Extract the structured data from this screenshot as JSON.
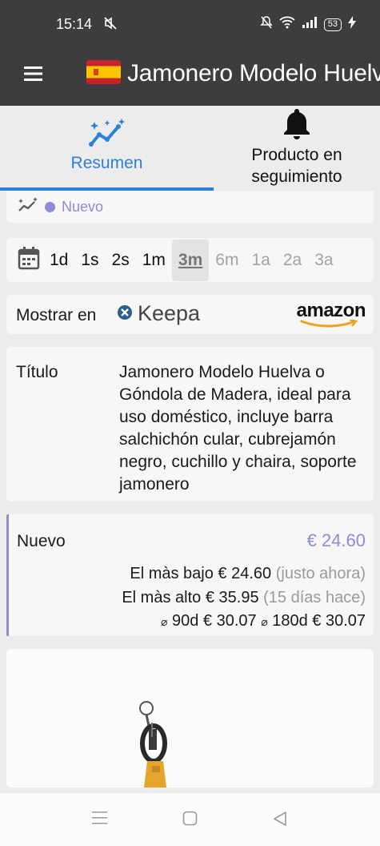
{
  "status_bar": {
    "time": "15:14",
    "battery": "53"
  },
  "app_bar": {
    "title": "Jamonero Modelo Huelva o Góndola de Madera"
  },
  "tabs": [
    {
      "label": "Resumen"
    },
    {
      "label": "Producto en seguimiento"
    }
  ],
  "condition_chip": {
    "label": "Nuevo"
  },
  "range": {
    "options": [
      "1d",
      "1s",
      "2s",
      "1m",
      "3m",
      "6m",
      "1a",
      "2a",
      "3a"
    ],
    "selected": "3m"
  },
  "show_in": {
    "label": "Mostrar en",
    "keepa": "Keepa",
    "amazon": "amazon"
  },
  "product": {
    "title_label": "Título",
    "title": "Jamonero Modelo Huelva o Góndola de Madera, ideal para uso doméstico, incluye barra salchichón cular, cubrejamón negro, cuchillo y chaira, soporte jamonero"
  },
  "price": {
    "condition": "Nuevo",
    "current": "€ 24.60",
    "lowest_label": "El màs bajo",
    "lowest_value": "€ 24.60",
    "lowest_note": "(justo ahora)",
    "highest_label": "El màs alto",
    "highest_value": "€ 35.95",
    "highest_note": "(15 días hace)",
    "avg_symbol": "⌀",
    "avg90_label": "90d",
    "avg90_value": "€ 30.07",
    "avg180_label": "180d",
    "avg180_value": "€ 30.07"
  },
  "colors": {
    "accent": "#2f80d8",
    "condition": "#8c8cd8",
    "bar": "#3d3d3d"
  }
}
